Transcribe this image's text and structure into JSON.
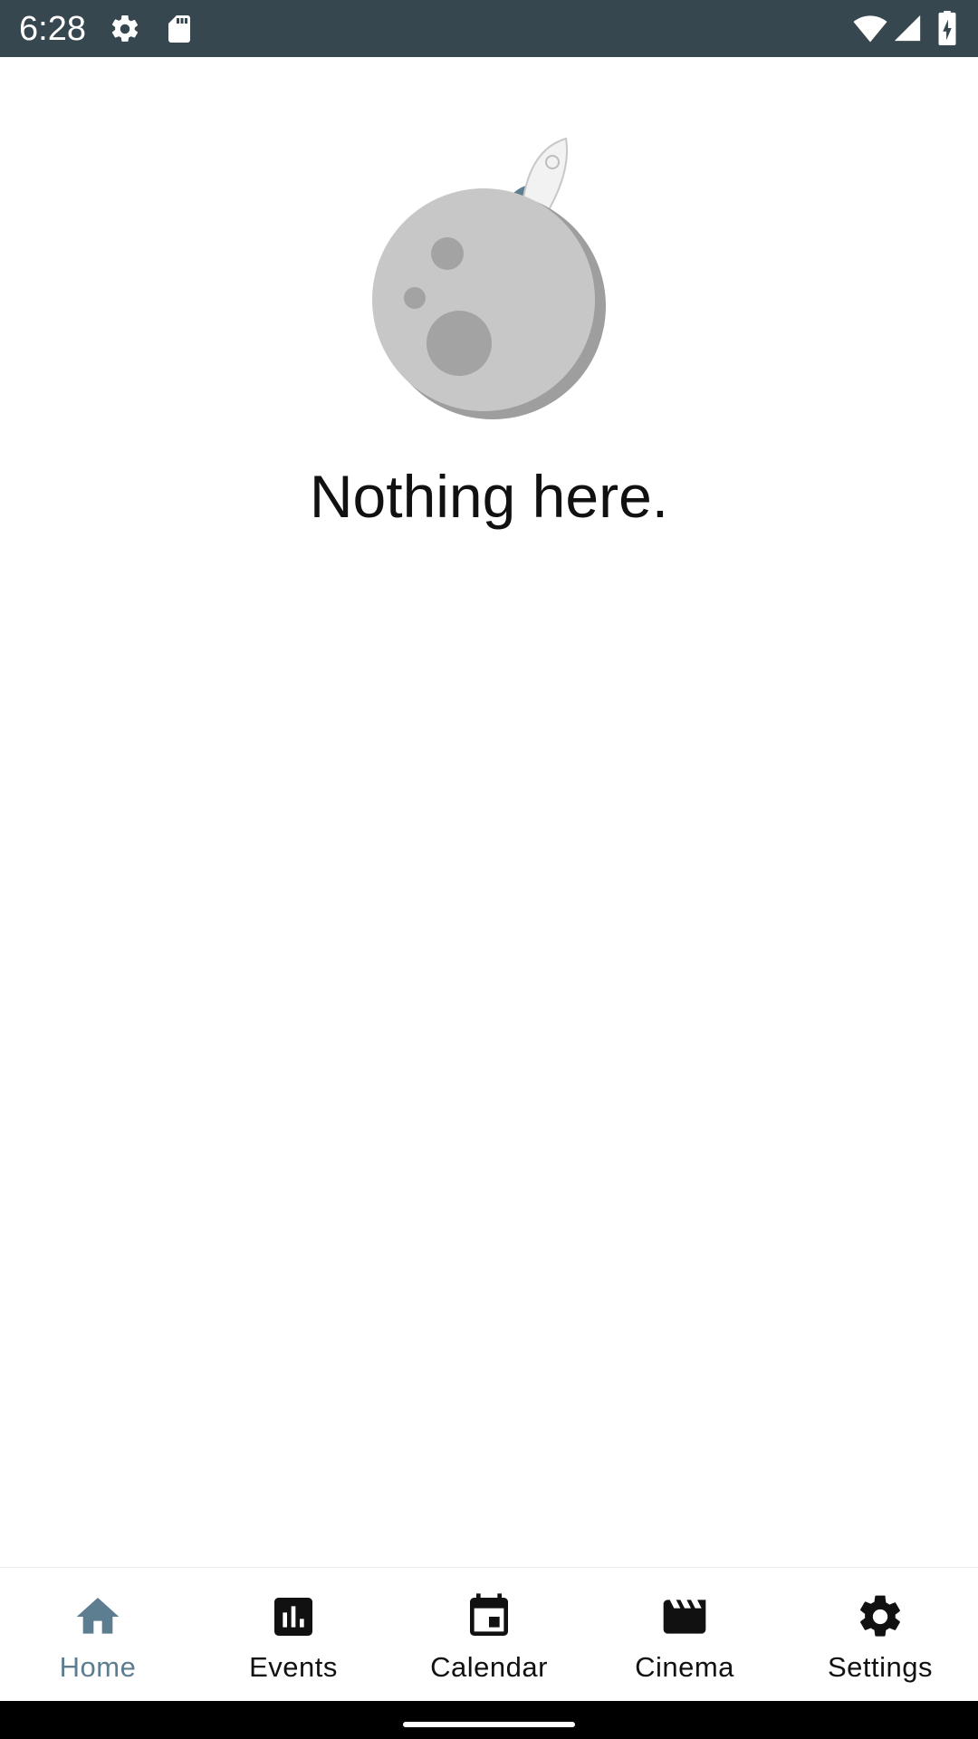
{
  "status_bar": {
    "time": "6:28",
    "icons": [
      "settings-icon",
      "sd-card-icon",
      "wifi-icon",
      "signal-icon",
      "battery-charging-icon"
    ]
  },
  "empty_state": {
    "illustration": "moon-rocket-illustration",
    "message": "Nothing here."
  },
  "bottom_nav": {
    "active": "Home",
    "accent_color": "#5d7d91",
    "items": [
      {
        "label": "Home",
        "icon": "home-icon"
      },
      {
        "label": "Events",
        "icon": "bar-chart-icon"
      },
      {
        "label": "Calendar",
        "icon": "calendar-icon"
      },
      {
        "label": "Cinema",
        "icon": "clapperboard-icon"
      },
      {
        "label": "Settings",
        "icon": "settings-icon"
      }
    ]
  }
}
